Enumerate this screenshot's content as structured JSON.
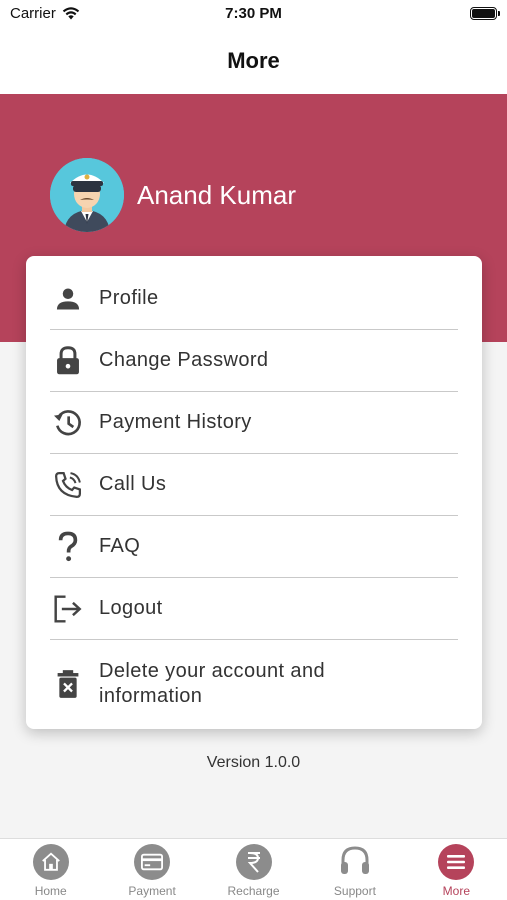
{
  "status_bar": {
    "carrier": "Carrier",
    "time": "7:30 PM"
  },
  "nav": {
    "title": "More"
  },
  "profile": {
    "name": "Anand Kumar"
  },
  "colors": {
    "brand": "#b5435b",
    "tab_inactive": "#8c8c8c"
  },
  "menu": {
    "items": [
      {
        "label": "Profile",
        "icon": "person-icon"
      },
      {
        "label": "Change Password",
        "icon": "lock-icon"
      },
      {
        "label": "Payment History",
        "icon": "history-icon"
      },
      {
        "label": "Call Us",
        "icon": "phone-icon"
      },
      {
        "label": "FAQ",
        "icon": "question-icon"
      },
      {
        "label": "Logout",
        "icon": "logout-icon"
      },
      {
        "label": "Delete your account and information",
        "icon": "delete-icon"
      }
    ]
  },
  "version": "Version 1.0.0",
  "tabs": [
    {
      "label": "Home",
      "icon": "home-icon",
      "active": false
    },
    {
      "label": "Payment",
      "icon": "card-icon",
      "active": false
    },
    {
      "label": "Recharge",
      "icon": "rupee-icon",
      "active": false
    },
    {
      "label": "Support",
      "icon": "headset-icon",
      "active": false
    },
    {
      "label": "More",
      "icon": "menu-icon",
      "active": true
    }
  ]
}
